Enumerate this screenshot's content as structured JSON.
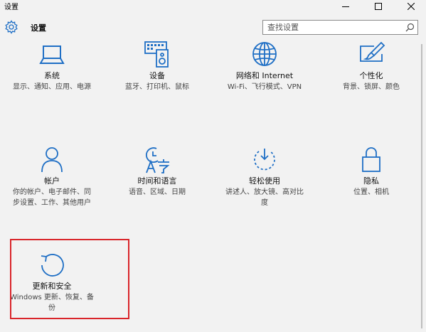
{
  "window": {
    "title": "设置"
  },
  "header": {
    "title": "设置",
    "search_placeholder": "查找设置"
  },
  "accent_color": "#1f6fc5",
  "highlight_color": "#d9252a",
  "tiles": [
    {
      "label": "系统",
      "desc": "显示、通知、应用、电源",
      "icon": "laptop-icon"
    },
    {
      "label": "设备",
      "desc": "蓝牙、打印机、鼠标",
      "icon": "keyboard-speaker-icon"
    },
    {
      "label": "网络和 Internet",
      "desc": "Wi-Fi、飞行模式、VPN",
      "icon": "globe-icon"
    },
    {
      "label": "个性化",
      "desc": "背景、锁屏、颜色",
      "icon": "paint-brush-icon"
    },
    {
      "label": "帐户",
      "desc": "你的帐户、电子邮件、同步设置、工作、其他用户",
      "icon": "person-icon"
    },
    {
      "label": "时间和语言",
      "desc": "语音、区域、日期",
      "icon": "time-language-icon"
    },
    {
      "label": "轻松使用",
      "desc": "讲述人、放大镜、高对比度",
      "icon": "ease-of-access-icon"
    },
    {
      "label": "隐私",
      "desc": "位置、相机",
      "icon": "lock-icon"
    },
    {
      "label": "更新和安全",
      "desc": "Windows 更新、恢复、备份",
      "icon": "refresh-icon"
    }
  ]
}
